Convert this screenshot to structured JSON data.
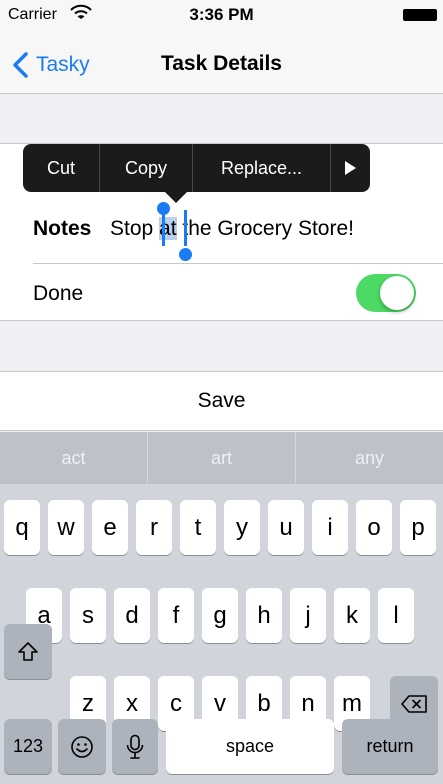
{
  "status_bar": {
    "carrier": "Carrier",
    "time": "3:36 PM",
    "wifi_icon": "wifi-icon",
    "battery_icon": "battery-icon"
  },
  "nav": {
    "back_label": "Tasky",
    "back_icon": "chevron-left-icon",
    "title": "Task Details"
  },
  "edit_menu": {
    "items": [
      "Cut",
      "Copy",
      "Replace..."
    ],
    "more_icon": "triangle-right-icon"
  },
  "notes": {
    "label": "Notes",
    "before": "Stop ",
    "selected": "at",
    "after": " the Grocery Store!"
  },
  "done": {
    "label": "Done",
    "toggle_on": true,
    "toggle_color": "#4cd964"
  },
  "save_label": "Save",
  "keyboard": {
    "suggestions": [
      "act",
      "art",
      "any"
    ],
    "row1": [
      "q",
      "w",
      "e",
      "r",
      "t",
      "y",
      "u",
      "i",
      "o",
      "p"
    ],
    "row2": [
      "a",
      "s",
      "d",
      "f",
      "g",
      "h",
      "j",
      "k",
      "l"
    ],
    "row3": [
      "z",
      "x",
      "c",
      "v",
      "b",
      "n",
      "m"
    ],
    "shift_icon": "shift-icon",
    "delete_icon": "delete-icon",
    "numbers_label": "123",
    "emoji_icon": "emoji-icon",
    "mic_icon": "microphone-icon",
    "space_label": "space",
    "return_label": "return"
  },
  "accent_color": "#1a7cf5"
}
